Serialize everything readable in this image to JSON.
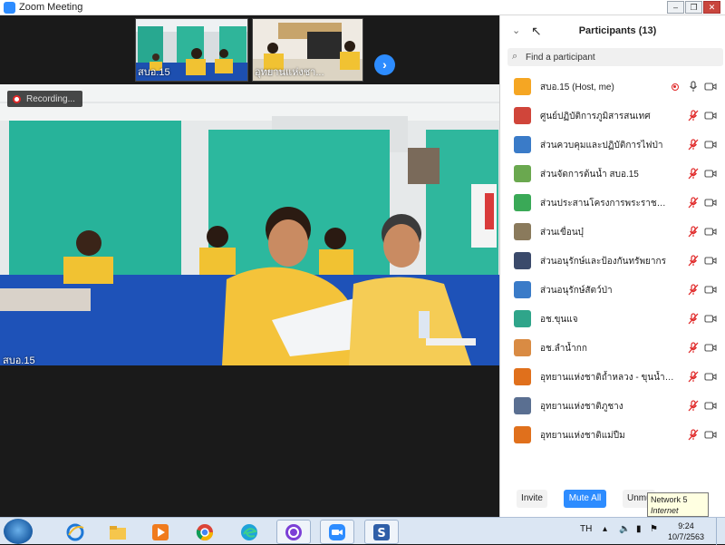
{
  "window": {
    "title": "Zoom Meeting"
  },
  "thumbnails": [
    {
      "name": "สบอ.15"
    },
    {
      "name": "อุทยานแห่งชา..."
    }
  ],
  "main_video": {
    "recording_label": "Recording...",
    "speaker_name": "สบอ.15"
  },
  "panel": {
    "title": "Participants (13)",
    "search_placeholder": "Find a participant",
    "participants": [
      {
        "name": "สบอ.15 (Host, me)",
        "avatar_color": "#f5a623",
        "muted": false,
        "recording": true
      },
      {
        "name": "ศูนย์ปฏิบัติการภูมิสารสนเทศ",
        "avatar_color": "#d0453a",
        "muted": true
      },
      {
        "name": "ส่วนควบคุมและปฏิบัติการไฟป่า",
        "avatar_color": "#3a7bc8",
        "muted": true
      },
      {
        "name": "ส่วนจัดการต้นน้ำ สบอ.15",
        "avatar_color": "#6aa84f",
        "muted": true
      },
      {
        "name": "ส่วนประสานโครงการพระราชดำริฯ",
        "avatar_color": "#3aa957",
        "muted": true
      },
      {
        "name": "ส่วนเขื่อนบุ๋",
        "avatar_color": "#8a7a5c",
        "muted": true
      },
      {
        "name": "ส่วนอนุรักษ์และป้องกันทรัพยากร",
        "avatar_color": "#3b4a6b",
        "muted": true
      },
      {
        "name": "ส่วนอนุรักษ์สัตว์ป่า",
        "avatar_color": "#3a7bc8",
        "muted": true
      },
      {
        "name": "อช.ขุนแจ",
        "avatar_color": "#2fa58a",
        "muted": true
      },
      {
        "name": "อช.ลำน้ำกก",
        "avatar_color": "#d98b43",
        "muted": true
      },
      {
        "name": "อุทยานแห่งชาติถ้ำหลวง - ขุนน้ำนางนอน (เ...",
        "avatar_color": "#e0701c",
        "muted": true
      },
      {
        "name": "อุทยานแห่งชาติภูชาง",
        "avatar_color": "#5a6f91",
        "muted": true
      },
      {
        "name": "อุทยานแห่งชาติแม่ปืม",
        "avatar_color": "#e0701c",
        "muted": true
      }
    ],
    "footer": {
      "invite": "Invite",
      "mute_all": "Mute All",
      "unmute": "Unmu"
    }
  },
  "tooltip": {
    "line1": "Network 5",
    "line2": "Internet access"
  },
  "taskbar": {
    "language": "TH",
    "time": "9:24",
    "date": "10/7/2563"
  },
  "colors": {
    "accent": "#2d8cff",
    "muted_red": "#e02828"
  }
}
